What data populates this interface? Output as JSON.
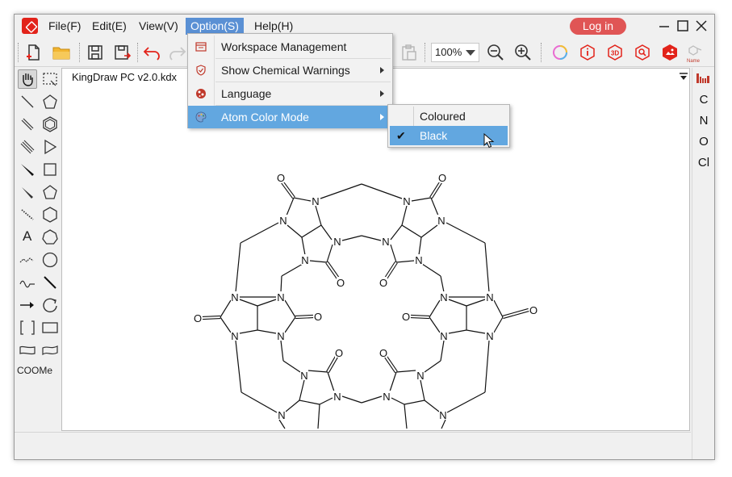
{
  "menu": {
    "file": "File(F)",
    "edit": "Edit(E)",
    "view": "View(V)",
    "option": "Option(S)",
    "help": "Help(H)"
  },
  "login_label": "Log in",
  "toolbar": {
    "zoom_value": "100%",
    "name_label": "Name"
  },
  "document_tab": "KingDraw PC v2.0.kdx",
  "left_panel": {
    "text_tool": "A",
    "group_label": "COOMe"
  },
  "right_panel": {
    "elements": [
      "C",
      "N",
      "O",
      "Cl"
    ]
  },
  "option_menu": {
    "items": [
      {
        "label": "Workspace Management",
        "icon": "workspace-icon",
        "has_submenu": false
      },
      {
        "label": "Show Chemical Warnings",
        "icon": "shield-icon",
        "has_submenu": true
      },
      {
        "label": "Language",
        "icon": "language-icon",
        "has_submenu": true
      },
      {
        "label": "Atom Color Mode",
        "icon": "palette-icon",
        "has_submenu": true
      }
    ],
    "highlighted": "Atom Color Mode"
  },
  "color_mode_submenu": {
    "items": [
      {
        "label": "Coloured",
        "checked": false
      },
      {
        "label": "Black",
        "checked": true
      }
    ]
  },
  "atom_labels": {
    "nitrogen": "N",
    "oxygen": "O"
  },
  "colors": {
    "accent_highlight": "#62a7e0",
    "login_button": "#e05555",
    "logo": "#e2231a",
    "active_menu": "#5a90d4"
  }
}
